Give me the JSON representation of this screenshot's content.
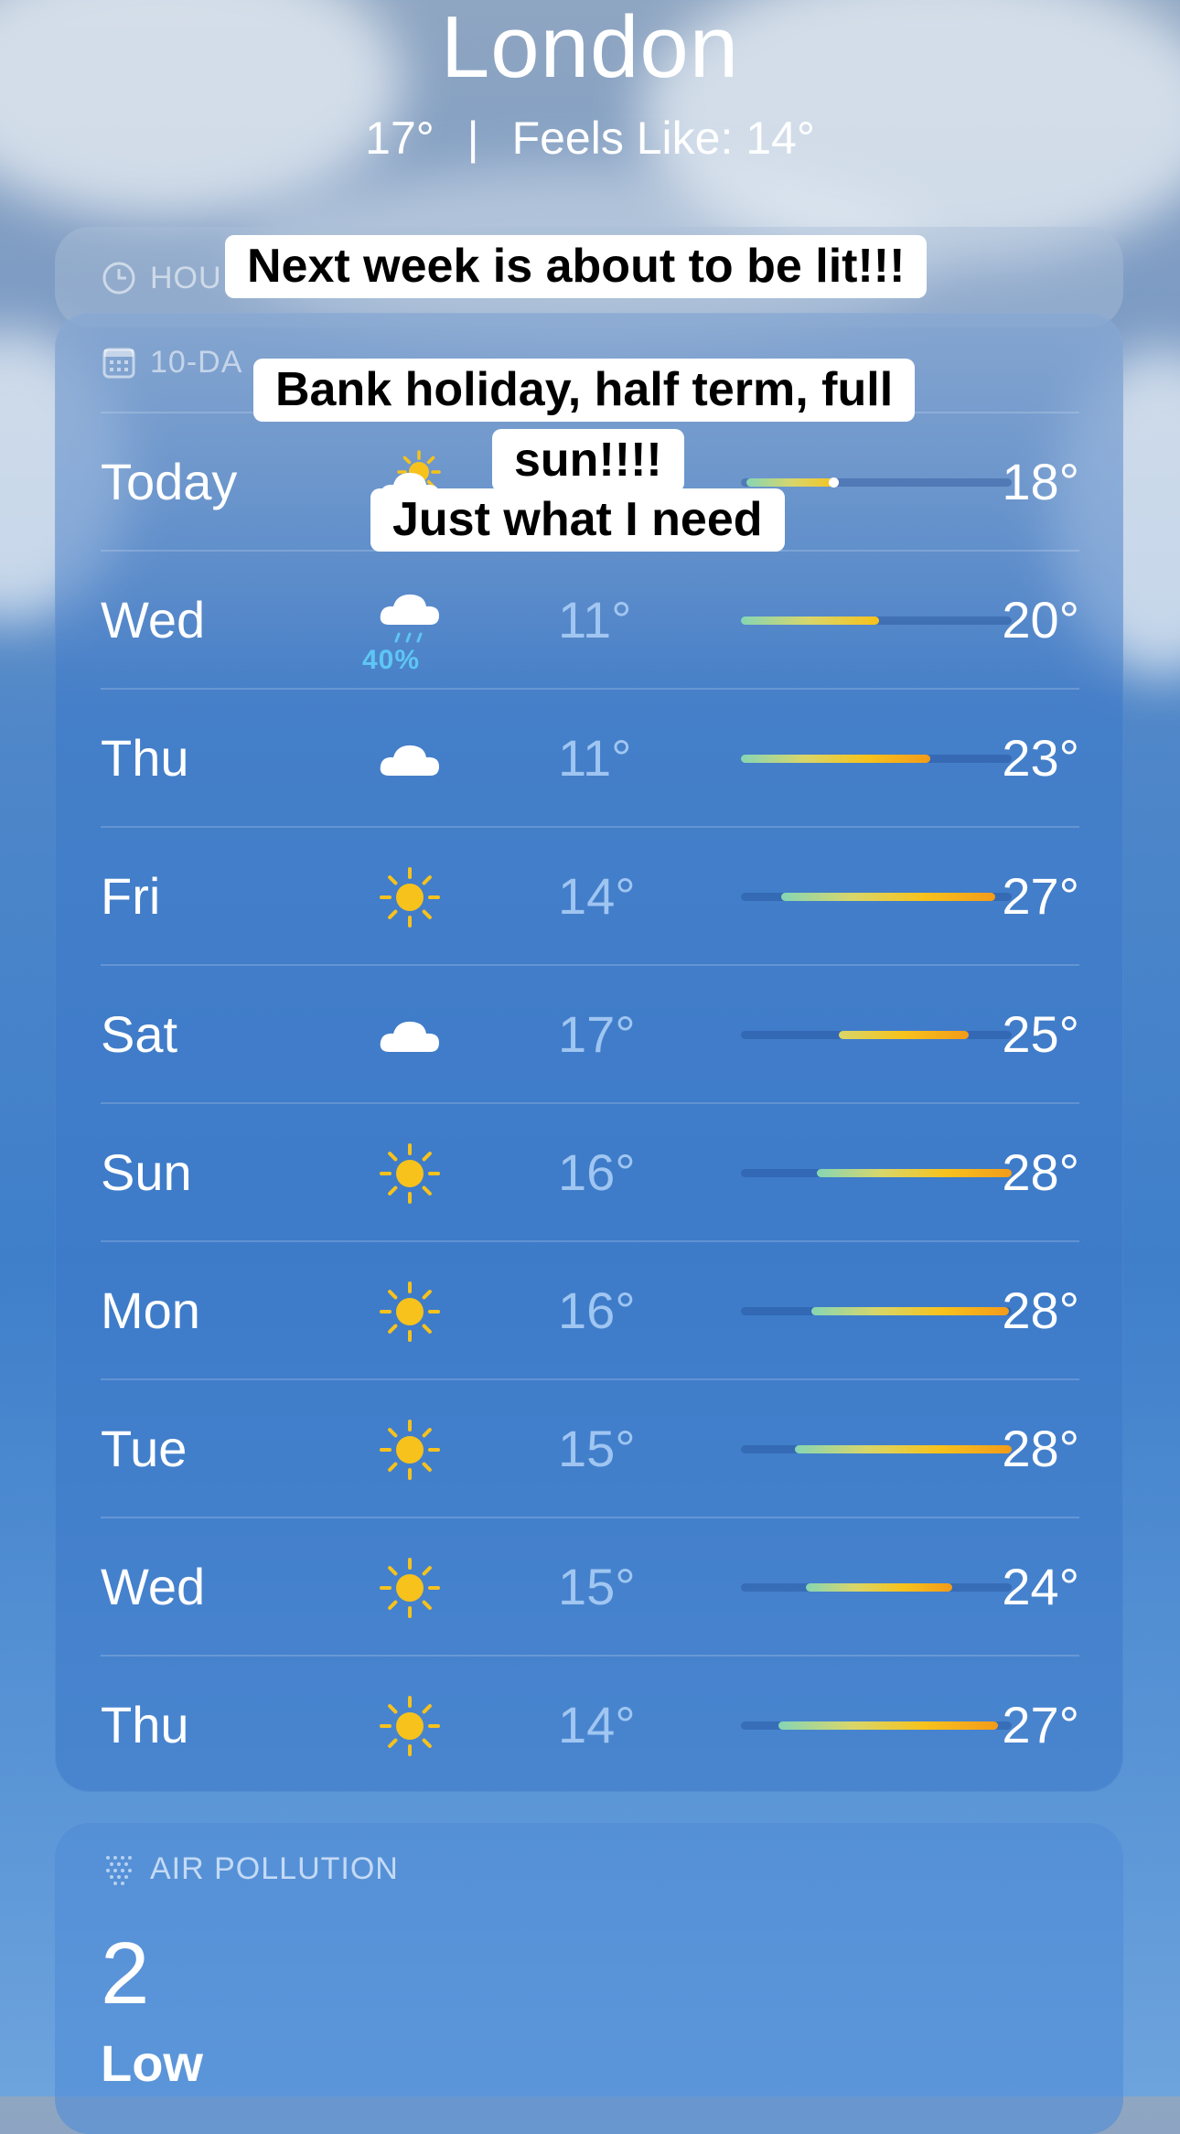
{
  "location": {
    "city": "London",
    "temp": "17°",
    "separator": "|",
    "feels_like": "Feels Like: 14°"
  },
  "hourly": {
    "label": "HOU"
  },
  "forecast": {
    "label": "10-DA",
    "days": [
      {
        "day": "Today",
        "icon": "partly-sunny-icon",
        "lo": "",
        "hi": "18°",
        "range": [
          0.02,
          0.36
        ],
        "now": 0.34
      },
      {
        "day": "Wed",
        "icon": "rain-cloud-icon",
        "precip": "40%",
        "lo": "11°",
        "hi": "20°",
        "range": [
          0.0,
          0.51
        ]
      },
      {
        "day": "Thu",
        "icon": "cloud-icon",
        "lo": "11°",
        "hi": "23°",
        "range": [
          0.0,
          0.7
        ]
      },
      {
        "day": "Fri",
        "icon": "sun-icon",
        "lo": "14°",
        "hi": "27°",
        "range": [
          0.15,
          0.94
        ]
      },
      {
        "day": "Sat",
        "icon": "cloud-icon",
        "lo": "17°",
        "hi": "25°",
        "range": [
          0.36,
          0.84
        ]
      },
      {
        "day": "Sun",
        "icon": "sun-icon",
        "lo": "16°",
        "hi": "28°",
        "range": [
          0.28,
          1.0
        ]
      },
      {
        "day": "Mon",
        "icon": "sun-icon",
        "lo": "16°",
        "hi": "28°",
        "range": [
          0.26,
          0.99
        ]
      },
      {
        "day": "Tue",
        "icon": "sun-icon",
        "lo": "15°",
        "hi": "28°",
        "range": [
          0.2,
          1.0
        ]
      },
      {
        "day": "Wed",
        "icon": "sun-icon",
        "lo": "15°",
        "hi": "24°",
        "range": [
          0.24,
          0.78
        ]
      },
      {
        "day": "Thu",
        "icon": "sun-icon",
        "lo": "14°",
        "hi": "27°",
        "range": [
          0.14,
          0.95
        ]
      }
    ]
  },
  "air": {
    "label": "AIR POLLUTION",
    "value": "2",
    "level": "Low"
  },
  "captions": [
    "Next week is about to be lit!!!",
    "Bank holiday, half term, full",
    "sun!!!!",
    "Just what I need"
  ],
  "colors": {
    "cool": "#86d6b4",
    "mild": "#d8d66a",
    "warm": "#f7c21c",
    "hot": "#f39b1a"
  }
}
